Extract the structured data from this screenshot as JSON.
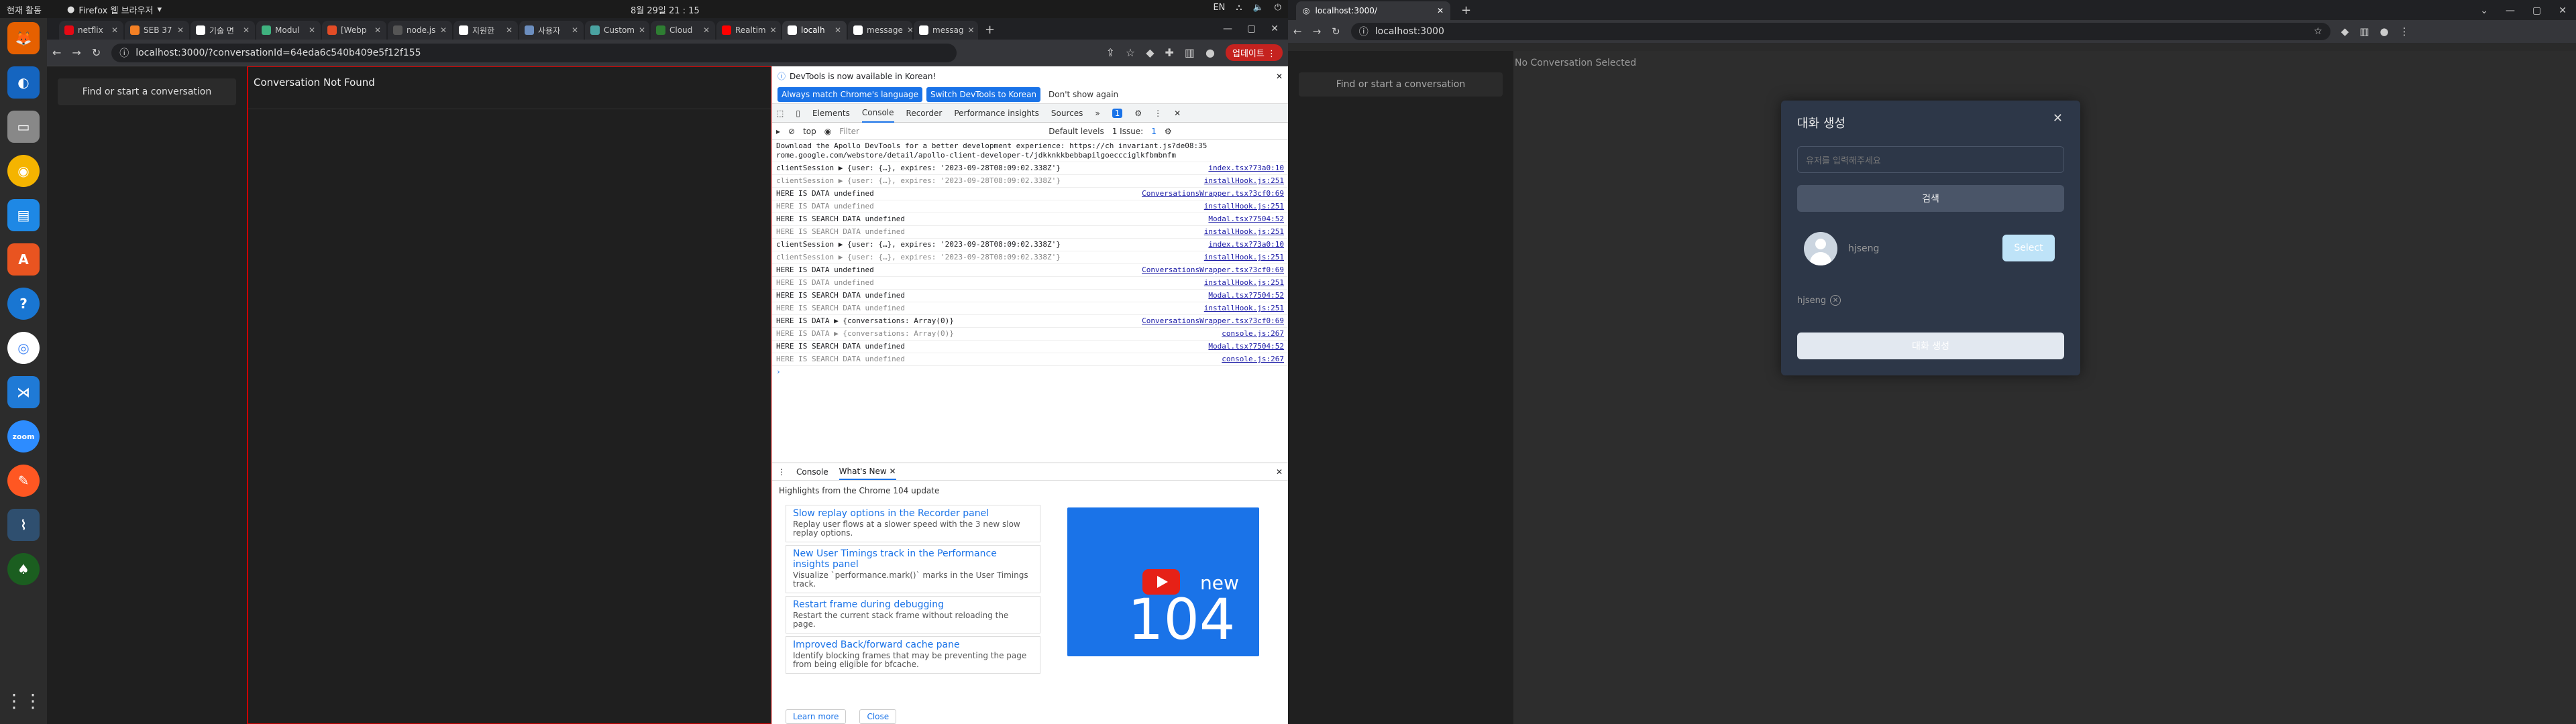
{
  "topbar": {
    "activities": "현재 활동",
    "app": "Firefox 웹 브라우저",
    "clock": "8월 29일  21 : 15",
    "lang": "EN"
  },
  "left_browser": {
    "tabs": [
      {
        "label": "netflix",
        "color": "#e50914"
      },
      {
        "label": "SEB 37",
        "color": "#f48024"
      },
      {
        "label": "기술 면",
        "color": "#ffffff"
      },
      {
        "label": "Modul",
        "color": "#3fb27f"
      },
      {
        "label": "[Webp",
        "color": "#e34c26"
      },
      {
        "label": "node.js",
        "color": "#555"
      },
      {
        "label": "지원한",
        "color": "#ffffff"
      },
      {
        "label": "사용자",
        "color": "#6c8ebf"
      },
      {
        "label": "Custom",
        "color": "#4aa3a2"
      },
      {
        "label": "Cloud",
        "color": "#2e7d32"
      },
      {
        "label": "Realtim",
        "color": "#ff0000"
      },
      {
        "label": "localh",
        "color": "#ffffff"
      },
      {
        "label": "message",
        "color": "#ffffff"
      },
      {
        "label": "messag",
        "color": "#ffffff"
      }
    ],
    "url": "localhost:3000/?conversationId=64eda6c540b409e5f12f155",
    "update_label": "업데이트",
    "app": {
      "find_label": "Find or start a conversation",
      "not_found": "Conversation Not Found"
    },
    "devtools": {
      "info": "DevTools is now available in Korean!",
      "btn_always": "Always match Chrome's language",
      "btn_switch": "Switch DevTools to Korean",
      "btn_dont": "Don't show again",
      "tabs": [
        "Elements",
        "Console",
        "Recorder",
        "Performance insights",
        "Sources"
      ],
      "badge": "1",
      "ctx": "top",
      "filter_placeholder": "Filter",
      "levels": "Default levels",
      "issues": "1 Issue:",
      "issues_count": "1",
      "rows": [
        {
          "text": "Download the Apollo DevTools for a better development experience: https://ch  invariant.js?de08:35 rome.google.com/webstore/detail/apollo-client-developer-t/jdkknkkbebbapilgoeccciglkfbmbnfm",
          "src": "",
          "dim": false
        },
        {
          "text": "clientSession ▶ {user: {…}, expires: '2023-09-28T08:09:02.338Z'}",
          "src": "index.tsx?73a0:10",
          "dim": false
        },
        {
          "text": "clientSession ▶ {user: {…}, expires: '2023-09-28T08:09:02.338Z'}",
          "src": "installHook.js:251",
          "dim": true
        },
        {
          "text": "HERE IS DATA undefined",
          "src": "ConversationsWrapper.tsx?3cf0:69",
          "dim": false
        },
        {
          "text": "HERE IS DATA undefined",
          "src": "installHook.js:251",
          "dim": true
        },
        {
          "text": "HERE IS SEARCH DATA undefined",
          "src": "Modal.tsx?7504:52",
          "dim": false
        },
        {
          "text": "HERE IS SEARCH DATA undefined",
          "src": "installHook.js:251",
          "dim": true
        },
        {
          "text": "clientSession ▶ {user: {…}, expires: '2023-09-28T08:09:02.338Z'}",
          "src": "index.tsx?73a0:10",
          "dim": false
        },
        {
          "text": "clientSession ▶ {user: {…}, expires: '2023-09-28T08:09:02.338Z'}",
          "src": "installHook.js:251",
          "dim": true
        },
        {
          "text": "HERE IS DATA undefined",
          "src": "ConversationsWrapper.tsx?3cf0:69",
          "dim": false
        },
        {
          "text": "HERE IS DATA undefined",
          "src": "installHook.js:251",
          "dim": true
        },
        {
          "text": "HERE IS SEARCH DATA undefined",
          "src": "Modal.tsx?7504:52",
          "dim": false
        },
        {
          "text": "HERE IS SEARCH DATA undefined",
          "src": "installHook.js:251",
          "dim": true
        },
        {
          "text": "HERE IS DATA ▶ {conversations: Array(0)}",
          "src": "ConversationsWrapper.tsx?3cf0:69",
          "dim": false
        },
        {
          "text": "HERE IS DATA ▶ {conversations: Array(0)}",
          "src": "console.js:267",
          "dim": true
        },
        {
          "text": "HERE IS SEARCH DATA undefined",
          "src": "Modal.tsx?7504:52",
          "dim": false
        },
        {
          "text": "HERE IS SEARCH DATA undefined",
          "src": "console.js:267",
          "dim": true
        }
      ],
      "drawer": {
        "tab_console": "Console",
        "tab_whatsnew": "What's New",
        "highlights": "Highlights from the Chrome 104 update",
        "cards": [
          {
            "title": "Slow replay options in the Recorder panel",
            "desc": "Replay user flows at a slower speed with the 3 new slow replay options."
          },
          {
            "title": "New User Timings track in the Performance insights panel",
            "desc": "Visualize `performance.mark()` marks in the User Timings track."
          },
          {
            "title": "Restart frame during debugging",
            "desc": "Restart the current stack frame without reloading the page."
          },
          {
            "title": "Improved Back/forward cache pane",
            "desc": "Identify blocking frames that may be preventing the page from being eligible for bfcache."
          }
        ],
        "promo_new": "new",
        "promo_num": "104",
        "learn": "Learn more",
        "close": "Close"
      }
    }
  },
  "right_browser": {
    "tab": "localhost:3000/",
    "url": "localhost:3000",
    "find_label": "Find or start a conversation",
    "no_conv": "No Conversation Selected",
    "modal": {
      "title": "대화 생성",
      "input_placeholder": "유저를 입력해주세요",
      "search": "검색",
      "user": "hjseng",
      "select": "Select",
      "chip": "hjseng",
      "create": "대화 생성"
    }
  }
}
